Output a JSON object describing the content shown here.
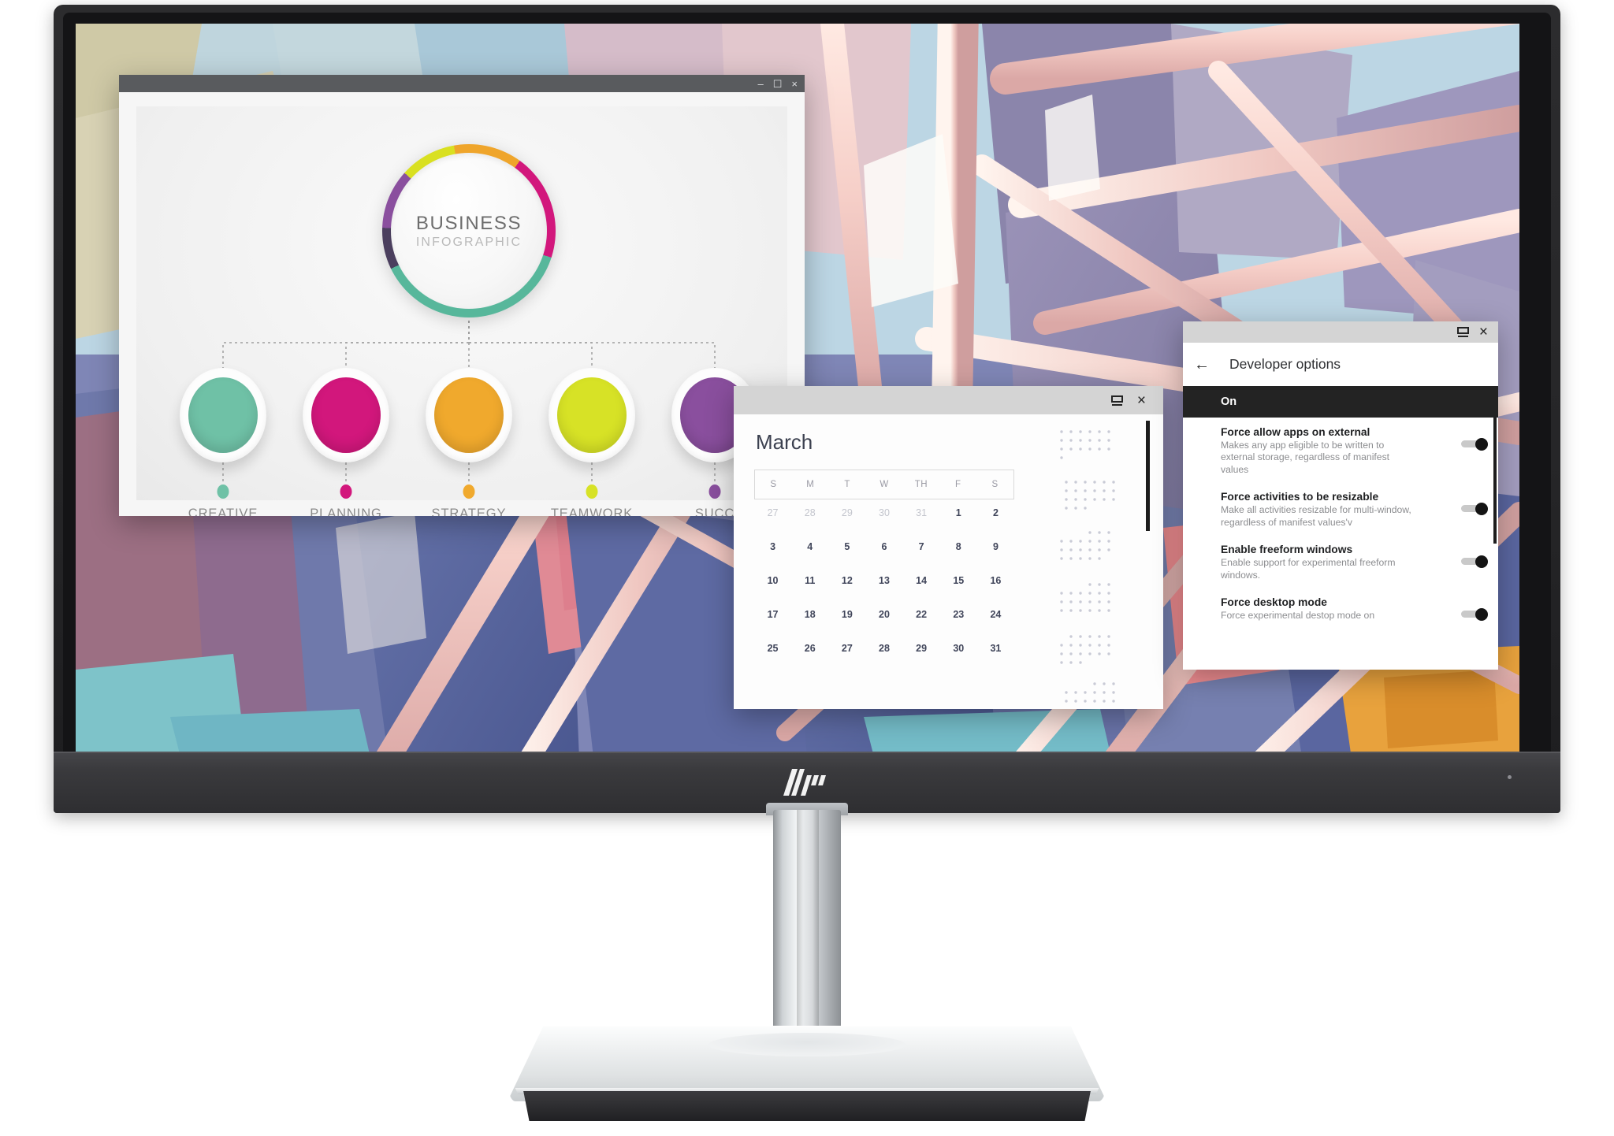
{
  "device": {
    "brand_logo": "hp-logo",
    "chin_indicator": "power-led"
  },
  "desktop": {
    "wallpaper_description": "abstract-architecture-beams"
  },
  "infographic_window": {
    "titlebar": {
      "minimize": "–",
      "maximize": "☐",
      "close": "×"
    },
    "center": {
      "line1": "BUSINESS",
      "line2": "INFOGRAPHIC"
    },
    "nodes": [
      {
        "label": "CREATIVE",
        "color": "#6fc1a6"
      },
      {
        "label": "PLANNING",
        "color": "#d2177c"
      },
      {
        "label": "STRATEGY",
        "color": "#f0a92d"
      },
      {
        "label": "TEAMWORK",
        "color": "#d7e226"
      },
      {
        "label": "SUCC",
        "color": "#8a4f9e"
      }
    ],
    "ring_colors": [
      "#57b79b",
      "#4b3f5e",
      "#8a4f9e",
      "#d9e021",
      "#efa52b",
      "#d2177c"
    ]
  },
  "calendar_window": {
    "titlebar": {
      "restore": "window-icon",
      "close": "×"
    },
    "month": "March",
    "day_headers": [
      "S",
      "M",
      "T",
      "W",
      "TH",
      "F",
      "S"
    ],
    "weeks": [
      [
        {
          "d": "27",
          "muted": true
        },
        {
          "d": "28",
          "muted": true
        },
        {
          "d": "29",
          "muted": true
        },
        {
          "d": "30",
          "muted": true
        },
        {
          "d": "31",
          "muted": true
        },
        {
          "d": "1",
          "muted": false
        },
        {
          "d": "2",
          "muted": false
        }
      ],
      [
        {
          "d": "3",
          "muted": false
        },
        {
          "d": "4",
          "muted": false
        },
        {
          "d": "5",
          "muted": false
        },
        {
          "d": "6",
          "muted": false
        },
        {
          "d": "7",
          "muted": false
        },
        {
          "d": "8",
          "muted": false
        },
        {
          "d": "9",
          "muted": false
        }
      ],
      [
        {
          "d": "10",
          "muted": false
        },
        {
          "d": "11",
          "muted": false
        },
        {
          "d": "12",
          "muted": false
        },
        {
          "d": "13",
          "muted": false
        },
        {
          "d": "14",
          "muted": false
        },
        {
          "d": "15",
          "muted": false
        },
        {
          "d": "16",
          "muted": false
        }
      ],
      [
        {
          "d": "17",
          "muted": false
        },
        {
          "d": "18",
          "muted": false
        },
        {
          "d": "19",
          "muted": false
        },
        {
          "d": "20",
          "muted": false
        },
        {
          "d": "22",
          "muted": false
        },
        {
          "d": "23",
          "muted": false
        },
        {
          "d": "24",
          "muted": false
        }
      ],
      [
        {
          "d": "25",
          "muted": false
        },
        {
          "d": "26",
          "muted": false
        },
        {
          "d": "27",
          "muted": false
        },
        {
          "d": "28",
          "muted": false
        },
        {
          "d": "29",
          "muted": false
        },
        {
          "d": "30",
          "muted": false
        },
        {
          "d": "31",
          "muted": false
        }
      ]
    ]
  },
  "developer_options_window": {
    "titlebar": {
      "restore": "window-icon",
      "close": "×"
    },
    "back_icon": "←",
    "title": "Developer options",
    "master_state": "On",
    "rows": [
      {
        "title": "Force allow apps on external",
        "desc": "Makes any app eligible to be written to external storage, regardless of manifest values",
        "toggle": "on"
      },
      {
        "title": "Force activities to be resizable",
        "desc": "Make all activities resizable for multi-window, regardless of manifest values'v",
        "toggle": "on"
      },
      {
        "title": "Enable freeform windows",
        "desc": "Enable support for experimental freeform windows.",
        "toggle": "on"
      },
      {
        "title": "Force desktop mode",
        "desc": "Force experimental destop mode on",
        "toggle": "on"
      }
    ]
  }
}
